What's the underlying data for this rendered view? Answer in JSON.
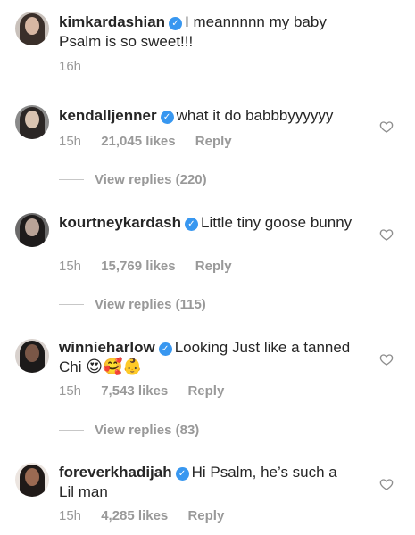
{
  "caption": {
    "username": "kimkardashian",
    "text": "I meannnnn my baby Psalm is so sweet!!!",
    "time": "16h"
  },
  "comments": [
    {
      "username": "kendalljenner",
      "text": "what it do babbbyyyyyy",
      "time": "15h",
      "likes": "21,045 likes",
      "reply": "Reply",
      "view_replies": "View replies (220)"
    },
    {
      "username": "kourtneykardash",
      "text": "Little tiny goose bunny",
      "time": "15h",
      "likes": "15,769 likes",
      "reply": "Reply",
      "view_replies": "View replies (115)"
    },
    {
      "username": "winnieharlow",
      "text": "Looking Just like a tanned Chi",
      "emoji": "😍🥰👶",
      "time": "15h",
      "likes": "7,543 likes",
      "reply": "Reply",
      "view_replies": "View replies (83)"
    },
    {
      "username": "foreverkhadijah",
      "text": "Hi Psalm, he’s such a Lil man",
      "time": "15h",
      "likes": "4,285 likes",
      "reply": "Reply"
    }
  ],
  "icons": {
    "verified": "verified-check-icon",
    "like": "heart-outline-icon"
  },
  "colors": {
    "text": "#262626",
    "meta": "#999999",
    "verified": "#3897f0",
    "divider": "#dbdbdb"
  }
}
